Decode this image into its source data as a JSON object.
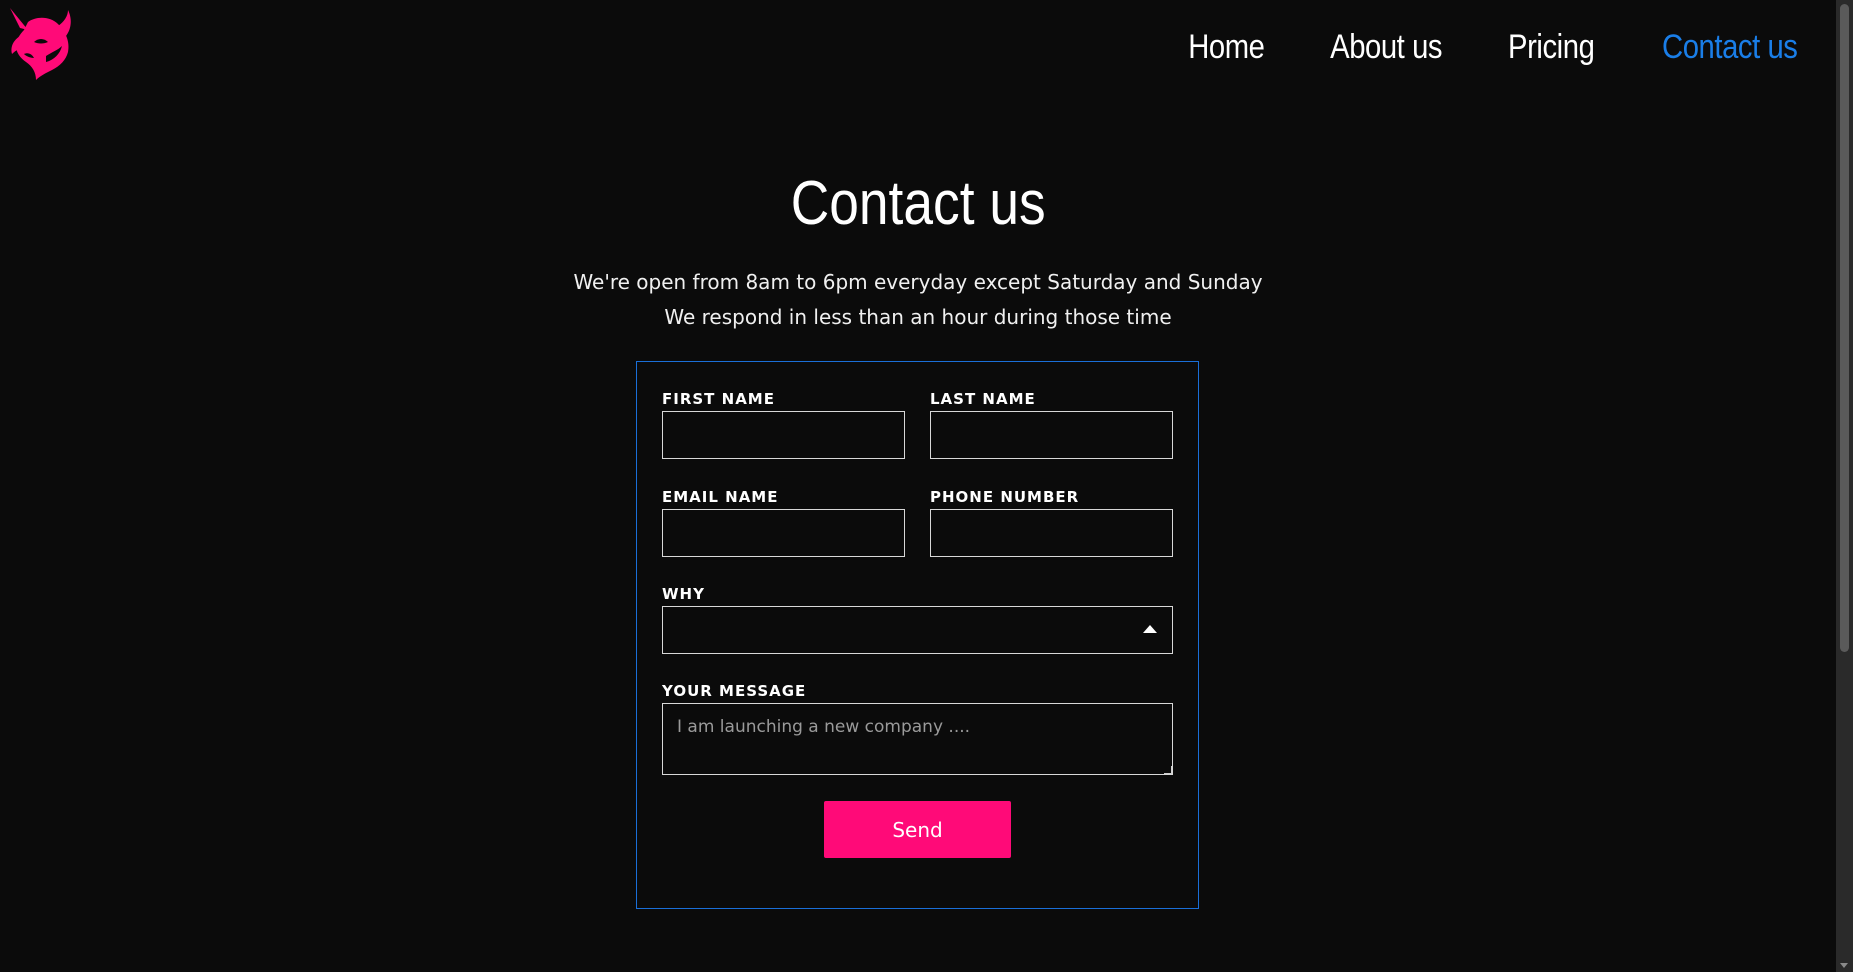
{
  "nav": {
    "items": [
      {
        "label": "Home",
        "active": false
      },
      {
        "label": "About us",
        "active": false
      },
      {
        "label": "Pricing",
        "active": false
      },
      {
        "label": "Contact us",
        "active": true
      }
    ]
  },
  "header": {
    "title": "Contact us",
    "subtitle_line1": "We're open from 8am to 6pm everyday except Saturday and Sunday",
    "subtitle_line2": "We respond in less than an hour during those time"
  },
  "form": {
    "first_name_label": "FIRST NAME",
    "first_name_value": "",
    "last_name_label": "LAST NAME",
    "last_name_value": "",
    "email_label": "EMAIL NAME",
    "email_value": "",
    "phone_label": "PHONE NUMBER",
    "phone_value": "",
    "why_label": "WHY",
    "why_value": "",
    "message_label": "YOUR MESSAGE",
    "message_placeholder": "I am launching a new company ....",
    "send_label": "Send"
  },
  "colors": {
    "background": "#0b0b0b",
    "accent_pink": "#ff0a78",
    "active_nav_blue": "#1a7ee8",
    "form_border_blue": "#1a6fd8"
  },
  "icons": {
    "logo": "unicorn-logo-icon",
    "select_caret": "caret-up-icon"
  }
}
